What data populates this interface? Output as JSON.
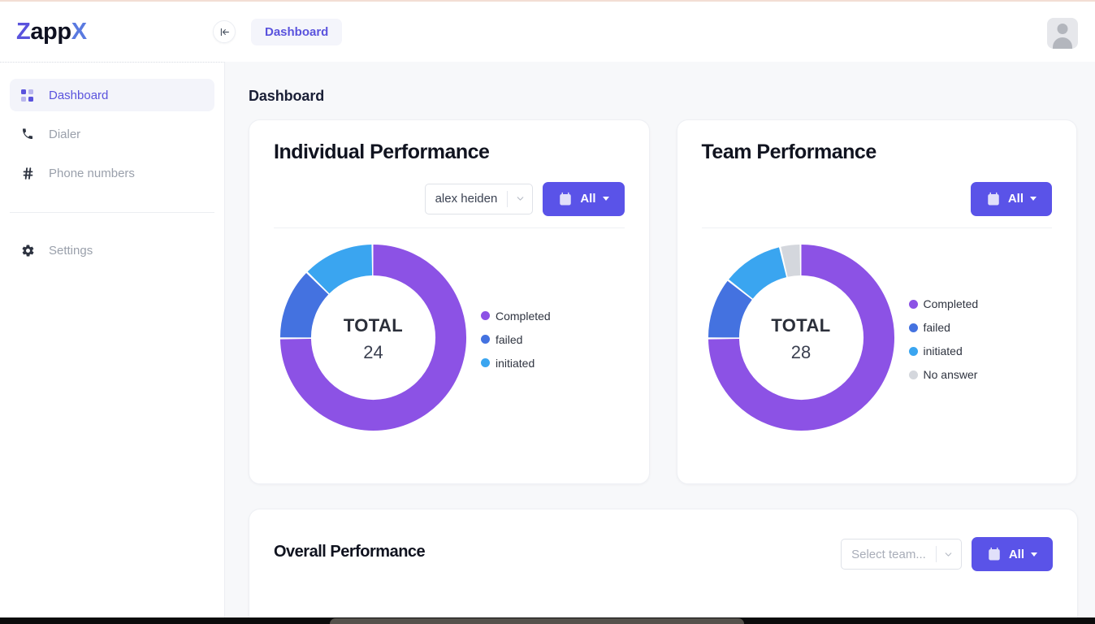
{
  "app": {
    "logo_prefix": "Z",
    "logo_mid": "app",
    "logo_suffix": "X",
    "accent": "#5a53dd",
    "button_accent": "#5a53e8"
  },
  "topbar": {
    "collapse_icon": "collapse-left-icon",
    "breadcrumb": "Dashboard",
    "avatar_icon": "user-avatar-icon"
  },
  "sidebar": {
    "items": [
      {
        "label": "Dashboard",
        "icon": "grid-icon",
        "active": true
      },
      {
        "label": "Dialer",
        "icon": "phone-icon",
        "active": false
      },
      {
        "label": "Phone numbers",
        "icon": "hash-icon",
        "active": false
      }
    ],
    "footer_items": [
      {
        "label": "Settings",
        "icon": "gear-icon",
        "active": false
      }
    ]
  },
  "main": {
    "page_title": "Dashboard"
  },
  "individual": {
    "title": "Individual Performance",
    "agent_select_value": "alex heiden",
    "date_button_label": "All",
    "date_button_icon": "calendar-icon"
  },
  "team": {
    "title": "Team Performance",
    "date_button_label": "All",
    "date_button_icon": "calendar-icon"
  },
  "overall": {
    "title": "Overall Performance",
    "team_select_placeholder": "Select team...",
    "date_button_label": "All",
    "date_button_icon": "calendar-icon"
  },
  "chart_data": [
    {
      "type": "pie",
      "title": "Individual Performance",
      "center_label": "TOTAL",
      "center_value": 24,
      "total": 24,
      "legend_position": "right",
      "categories": [
        "Completed",
        "failed",
        "initiated"
      ],
      "values": [
        18,
        3,
        3
      ],
      "colors": [
        "#8c52e5",
        "#4472e0",
        "#3aa5f0"
      ]
    },
    {
      "type": "pie",
      "title": "Team Performance",
      "center_label": "TOTAL",
      "center_value": 28,
      "total": 28,
      "legend_position": "right",
      "categories": [
        "Completed",
        "failed",
        "initiated",
        "No answer"
      ],
      "values": [
        21,
        3,
        3,
        1
      ],
      "colors": [
        "#8c52e5",
        "#4472e0",
        "#3aa5f0",
        "#d4d7dd"
      ]
    }
  ]
}
